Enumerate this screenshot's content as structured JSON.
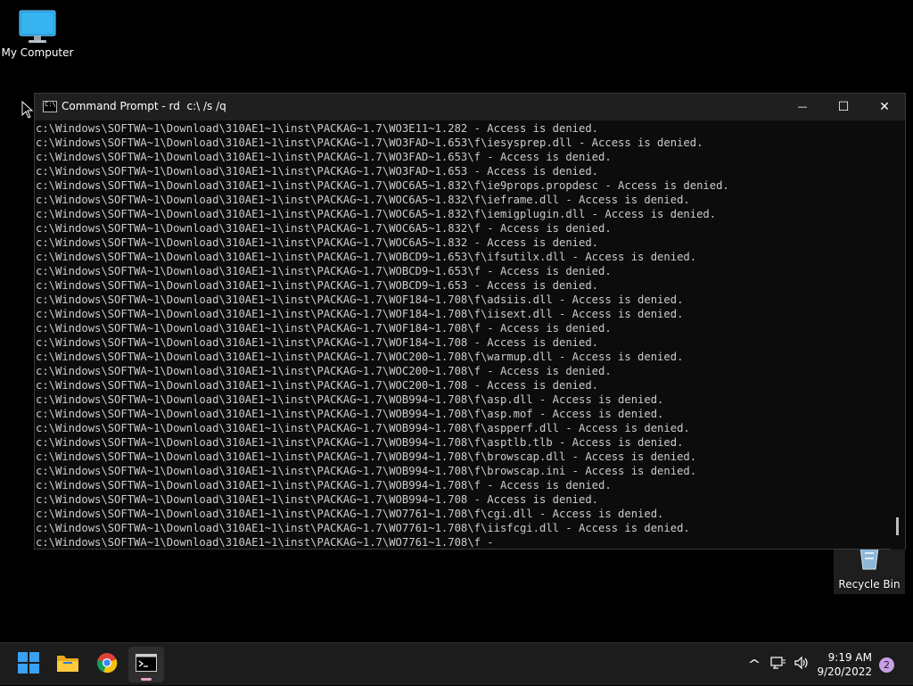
{
  "desktop": {
    "icons": [
      {
        "label": "My Computer",
        "icon": "monitor-icon"
      },
      {
        "label": "Recycle Bin",
        "icon": "recycle-bin-icon"
      }
    ]
  },
  "window": {
    "title": "Command Prompt - rd  c:\\ /s /q",
    "controls": {
      "minimize": "—",
      "maximize": "☐",
      "close": "✕"
    },
    "console_lines": [
      "c:\\Windows\\SOFTWA~1\\Download\\310AE1~1\\inst\\PACKAG~1.7\\WO3E11~1.282 - Access is denied.",
      "c:\\Windows\\SOFTWA~1\\Download\\310AE1~1\\inst\\PACKAG~1.7\\WO3FAD~1.653\\f\\iesysprep.dll - Access is denied.",
      "c:\\Windows\\SOFTWA~1\\Download\\310AE1~1\\inst\\PACKAG~1.7\\WO3FAD~1.653\\f - Access is denied.",
      "c:\\Windows\\SOFTWA~1\\Download\\310AE1~1\\inst\\PACKAG~1.7\\WO3FAD~1.653 - Access is denied.",
      "c:\\Windows\\SOFTWA~1\\Download\\310AE1~1\\inst\\PACKAG~1.7\\WOC6A5~1.832\\f\\ie9props.propdesc - Access is denied.",
      "c:\\Windows\\SOFTWA~1\\Download\\310AE1~1\\inst\\PACKAG~1.7\\WOC6A5~1.832\\f\\ieframe.dll - Access is denied.",
      "c:\\Windows\\SOFTWA~1\\Download\\310AE1~1\\inst\\PACKAG~1.7\\WOC6A5~1.832\\f\\iemigplugin.dll - Access is denied.",
      "c:\\Windows\\SOFTWA~1\\Download\\310AE1~1\\inst\\PACKAG~1.7\\WOC6A5~1.832\\f - Access is denied.",
      "c:\\Windows\\SOFTWA~1\\Download\\310AE1~1\\inst\\PACKAG~1.7\\WOC6A5~1.832 - Access is denied.",
      "c:\\Windows\\SOFTWA~1\\Download\\310AE1~1\\inst\\PACKAG~1.7\\WOBCD9~1.653\\f\\ifsutilx.dll - Access is denied.",
      "c:\\Windows\\SOFTWA~1\\Download\\310AE1~1\\inst\\PACKAG~1.7\\WOBCD9~1.653\\f - Access is denied.",
      "c:\\Windows\\SOFTWA~1\\Download\\310AE1~1\\inst\\PACKAG~1.7\\WOBCD9~1.653 - Access is denied.",
      "c:\\Windows\\SOFTWA~1\\Download\\310AE1~1\\inst\\PACKAG~1.7\\WOF184~1.708\\f\\adsiis.dll - Access is denied.",
      "c:\\Windows\\SOFTWA~1\\Download\\310AE1~1\\inst\\PACKAG~1.7\\WOF184~1.708\\f\\iisext.dll - Access is denied.",
      "c:\\Windows\\SOFTWA~1\\Download\\310AE1~1\\inst\\PACKAG~1.7\\WOF184~1.708\\f - Access is denied.",
      "c:\\Windows\\SOFTWA~1\\Download\\310AE1~1\\inst\\PACKAG~1.7\\WOF184~1.708 - Access is denied.",
      "c:\\Windows\\SOFTWA~1\\Download\\310AE1~1\\inst\\PACKAG~1.7\\WOC200~1.708\\f\\warmup.dll - Access is denied.",
      "c:\\Windows\\SOFTWA~1\\Download\\310AE1~1\\inst\\PACKAG~1.7\\WOC200~1.708\\f - Access is denied.",
      "c:\\Windows\\SOFTWA~1\\Download\\310AE1~1\\inst\\PACKAG~1.7\\WOC200~1.708 - Access is denied.",
      "c:\\Windows\\SOFTWA~1\\Download\\310AE1~1\\inst\\PACKAG~1.7\\WOB994~1.708\\f\\asp.dll - Access is denied.",
      "c:\\Windows\\SOFTWA~1\\Download\\310AE1~1\\inst\\PACKAG~1.7\\WOB994~1.708\\f\\asp.mof - Access is denied.",
      "c:\\Windows\\SOFTWA~1\\Download\\310AE1~1\\inst\\PACKAG~1.7\\WOB994~1.708\\f\\aspperf.dll - Access is denied.",
      "c:\\Windows\\SOFTWA~1\\Download\\310AE1~1\\inst\\PACKAG~1.7\\WOB994~1.708\\f\\asptlb.tlb - Access is denied.",
      "c:\\Windows\\SOFTWA~1\\Download\\310AE1~1\\inst\\PACKAG~1.7\\WOB994~1.708\\f\\browscap.dll - Access is denied.",
      "c:\\Windows\\SOFTWA~1\\Download\\310AE1~1\\inst\\PACKAG~1.7\\WOB994~1.708\\f\\browscap.ini - Access is denied.",
      "c:\\Windows\\SOFTWA~1\\Download\\310AE1~1\\inst\\PACKAG~1.7\\WOB994~1.708\\f - Access is denied.",
      "c:\\Windows\\SOFTWA~1\\Download\\310AE1~1\\inst\\PACKAG~1.7\\WOB994~1.708 - Access is denied.",
      "c:\\Windows\\SOFTWA~1\\Download\\310AE1~1\\inst\\PACKAG~1.7\\WO7761~1.708\\f\\cgi.dll - Access is denied.",
      "c:\\Windows\\SOFTWA~1\\Download\\310AE1~1\\inst\\PACKAG~1.7\\WO7761~1.708\\f\\iisfcgi.dll - Access is denied.",
      "c:\\Windows\\SOFTWA~1\\Download\\310AE1~1\\inst\\PACKAG~1.7\\WO7761~1.708\\f -"
    ]
  },
  "taskbar": {
    "apps": [
      {
        "name": "start-button",
        "icon": "windows-logo-icon"
      },
      {
        "name": "file-explorer-button",
        "icon": "folder-icon"
      },
      {
        "name": "chrome-button",
        "icon": "chrome-icon"
      },
      {
        "name": "command-prompt-button",
        "icon": "terminal-icon",
        "active": true
      }
    ],
    "tray": {
      "chevron": "^",
      "time": "9:19 AM",
      "date": "9/20/2022",
      "notification_count": "2"
    }
  }
}
